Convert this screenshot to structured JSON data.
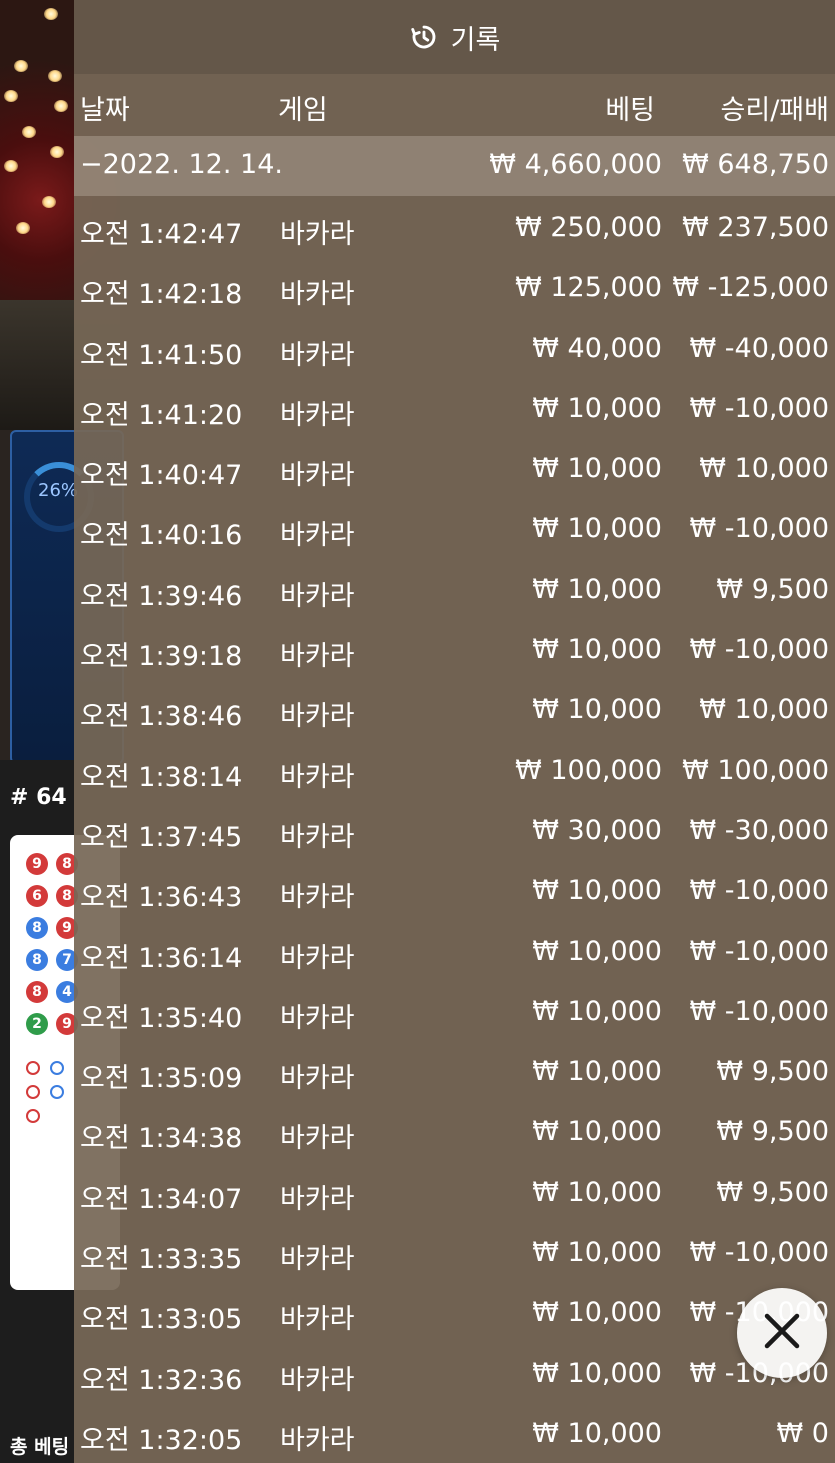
{
  "background": {
    "progress_label": "26%",
    "round_label": "# 64",
    "total_bet_label": "총 베팅",
    "bead_road": [
      [
        "9",
        "8"
      ],
      [
        "6",
        "8"
      ],
      [
        "8",
        "9"
      ],
      [
        "8",
        "7"
      ],
      [
        "8",
        "4"
      ],
      [
        "2",
        "9"
      ]
    ]
  },
  "history": {
    "title": "기록",
    "icon": "history-icon",
    "columns": {
      "date": "날짜",
      "game": "게임",
      "bet": "베팅",
      "win_loss": "승리/패배"
    },
    "groups": [
      {
        "date": "−2022. 12. 14.",
        "total_bet": "₩ 4,660,000",
        "total_win_loss": "₩ 648,750",
        "rows": [
          {
            "time": "오전 1:42:47",
            "game": "바카라",
            "bet": "₩ 250,000",
            "win_loss": "₩ 237,500"
          },
          {
            "time": "오전 1:42:18",
            "game": "바카라",
            "bet": "₩ 125,000",
            "win_loss": "₩ -125,000"
          },
          {
            "time": "오전 1:41:50",
            "game": "바카라",
            "bet": "₩ 40,000",
            "win_loss": "₩ -40,000"
          },
          {
            "time": "오전 1:41:20",
            "game": "바카라",
            "bet": "₩ 10,000",
            "win_loss": "₩ -10,000"
          },
          {
            "time": "오전 1:40:47",
            "game": "바카라",
            "bet": "₩ 10,000",
            "win_loss": "₩ 10,000"
          },
          {
            "time": "오전 1:40:16",
            "game": "바카라",
            "bet": "₩ 10,000",
            "win_loss": "₩ -10,000"
          },
          {
            "time": "오전 1:39:46",
            "game": "바카라",
            "bet": "₩ 10,000",
            "win_loss": "₩ 9,500"
          },
          {
            "time": "오전 1:39:18",
            "game": "바카라",
            "bet": "₩ 10,000",
            "win_loss": "₩ -10,000"
          },
          {
            "time": "오전 1:38:46",
            "game": "바카라",
            "bet": "₩ 10,000",
            "win_loss": "₩ 10,000"
          },
          {
            "time": "오전 1:38:14",
            "game": "바카라",
            "bet": "₩ 100,000",
            "win_loss": "₩ 100,000"
          },
          {
            "time": "오전 1:37:45",
            "game": "바카라",
            "bet": "₩ 30,000",
            "win_loss": "₩ -30,000"
          },
          {
            "time": "오전 1:36:43",
            "game": "바카라",
            "bet": "₩ 10,000",
            "win_loss": "₩ -10,000"
          },
          {
            "time": "오전 1:36:14",
            "game": "바카라",
            "bet": "₩ 10,000",
            "win_loss": "₩ -10,000"
          },
          {
            "time": "오전 1:35:40",
            "game": "바카라",
            "bet": "₩ 10,000",
            "win_loss": "₩ -10,000"
          },
          {
            "time": "오전 1:35:09",
            "game": "바카라",
            "bet": "₩ 10,000",
            "win_loss": "₩ 9,500"
          },
          {
            "time": "오전 1:34:38",
            "game": "바카라",
            "bet": "₩ 10,000",
            "win_loss": "₩ 9,500"
          },
          {
            "time": "오전 1:34:07",
            "game": "바카라",
            "bet": "₩ 10,000",
            "win_loss": "₩ 9,500"
          },
          {
            "time": "오전 1:33:35",
            "game": "바카라",
            "bet": "₩ 10,000",
            "win_loss": "₩ -10,000"
          },
          {
            "time": "오전 1:33:05",
            "game": "바카라",
            "bet": "₩ 10,000",
            "win_loss": "₩ -10,000"
          },
          {
            "time": "오전 1:32:36",
            "game": "바카라",
            "bet": "₩ 10,000",
            "win_loss": "₩ -10,000"
          },
          {
            "time": "오전 1:32:05",
            "game": "바카라",
            "bet": "₩ 10,000",
            "win_loss": "₩ 0"
          }
        ]
      }
    ],
    "close_icon": "close-icon"
  }
}
